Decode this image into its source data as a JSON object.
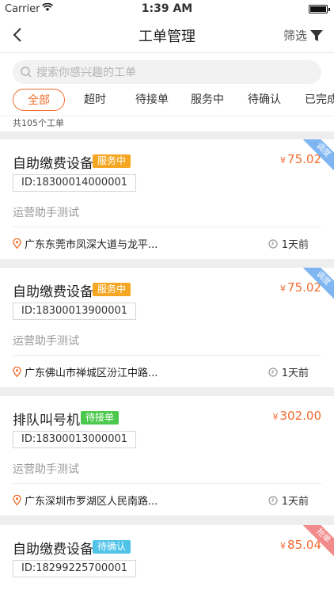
{
  "status_bar": {
    "carrier": "Carrier",
    "time": "1:39 AM"
  },
  "navbar": {
    "title": "工单管理",
    "filter_label": "筛选"
  },
  "search": {
    "placeholder": "搜索你感兴趣的工单"
  },
  "tabs": [
    {
      "label": "全部",
      "active": true
    },
    {
      "label": "超时"
    },
    {
      "label": "待接单"
    },
    {
      "label": "服务中"
    },
    {
      "label": "待确认"
    },
    {
      "label": "已完成"
    }
  ],
  "count_text": "共105个工单",
  "colors": {
    "accent": "#f26c2f",
    "badge_service": "#f5a623",
    "badge_waiting": "#4cc94c",
    "badge_confirm": "#4fc3e8",
    "ribbon_dispatch": "#7fb6f2",
    "ribbon_grab": "#f28b8b"
  },
  "currency": "¥",
  "orders": [
    {
      "name": "自助缴费设备",
      "status": "服务中",
      "price": "75.02",
      "id": "ID:18300014000001",
      "desc": "运营助手测试",
      "address": "广东东莞市凤深大道与龙平...",
      "ago": "1天前",
      "ribbon": "调度"
    },
    {
      "name": "自助缴费设备",
      "status": "服务中",
      "price": "75.02",
      "id": "ID:18300013900001",
      "desc": "运营助手测试",
      "address": "广东佛山市禅城区汾江中路...",
      "ago": "1天前",
      "ribbon": "调度"
    },
    {
      "name": "排队叫号机",
      "status": "待接单",
      "price": "302.00",
      "id": "ID:18300013000001",
      "desc": "运营助手测试",
      "address": "广东深圳市罗湖区人民南路...",
      "ago": "1天前",
      "ribbon": ""
    },
    {
      "name": "自助缴费设备",
      "status": "待确认",
      "price": "85.04",
      "id": "ID:18299225700001",
      "desc": "",
      "address": "",
      "ago": "",
      "ribbon": "抢单"
    }
  ]
}
